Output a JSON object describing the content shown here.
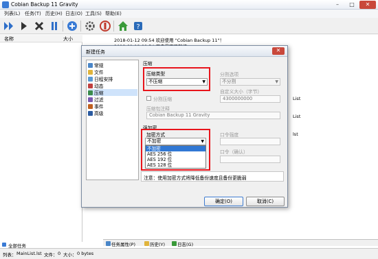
{
  "window": {
    "title": "Cobian Backup 11 Gravity",
    "controls": {
      "minimize": "–",
      "maximize": "□",
      "close": "✕"
    }
  },
  "menu": [
    "列表(L)",
    "任务(T)",
    "历史(H)",
    "日志(O)",
    "工具(S)",
    "帮助(E)"
  ],
  "toolbar_icons": [
    "run-all-icon",
    "run-icon",
    "stop-icon",
    "pause-icon",
    "add-task-icon",
    "settings-icon",
    "deactivate-icon",
    "home-icon",
    "help-icon"
  ],
  "list_header": {
    "name": "名称",
    "size": "大小"
  },
  "log_lines": [
    "2018-01-12 09:54 欢迎使用 \"Cobian Backup 11\"！",
    "2018-01-12 09:54 用户界面已就绪。"
  ],
  "right_fragments": [
    "List",
    "List",
    "lst"
  ],
  "all_tasks": "全部任务",
  "bottom_tabs": [
    "任务属性(P)",
    "历史(Y)",
    "日志(G)"
  ],
  "status": {
    "list_label": "列表：",
    "list_value": "MainList.lst",
    "files_label": "文件：",
    "files_value": "0",
    "size_label": "大小：",
    "size_value": "0 bytes"
  },
  "dialog": {
    "title": "新建任务",
    "nav": [
      {
        "label": "常规",
        "color": "#4a86c8"
      },
      {
        "label": "文件",
        "color": "#e0b43c"
      },
      {
        "label": "日程安排",
        "color": "#5a9ad4"
      },
      {
        "label": "动态",
        "color": "#c04040"
      },
      {
        "label": "压缩",
        "color": "#3c8c4c"
      },
      {
        "label": "过滤",
        "color": "#7a5ab0"
      },
      {
        "label": "事件",
        "color": "#c06020"
      },
      {
        "label": "高级",
        "color": "#2a5aa0"
      }
    ],
    "nav_selected_index": 4,
    "compression_group": "压缩",
    "compression_type_label": "压缩类型",
    "compression_type_value": "不压缩",
    "split_label": "分割选项",
    "split_value": "不分割",
    "custom_size_label": "自定义大小（字节）",
    "custom_size_value": "4300000000",
    "split_compress_label": "分割压缩",
    "compress_comment_label": "压缩包注释",
    "compress_comment_value": "Cobian Backup 11 Gravity",
    "encryption_group": "强加密",
    "encryption_method_label": "加密方式",
    "encryption_method_value": "不加密",
    "encryption_options": [
      "不加密",
      "AES 256 位",
      "AES 192 位",
      "AES 128 位"
    ],
    "encryption_selected_index": 0,
    "password_label": "口令强度",
    "password_confirm_label": "口令（确认）",
    "note": "注意：使用加密方式将降低备份速度且备份更脆弱",
    "ok_label": "确定(O)",
    "cancel_label": "取消(C)"
  }
}
